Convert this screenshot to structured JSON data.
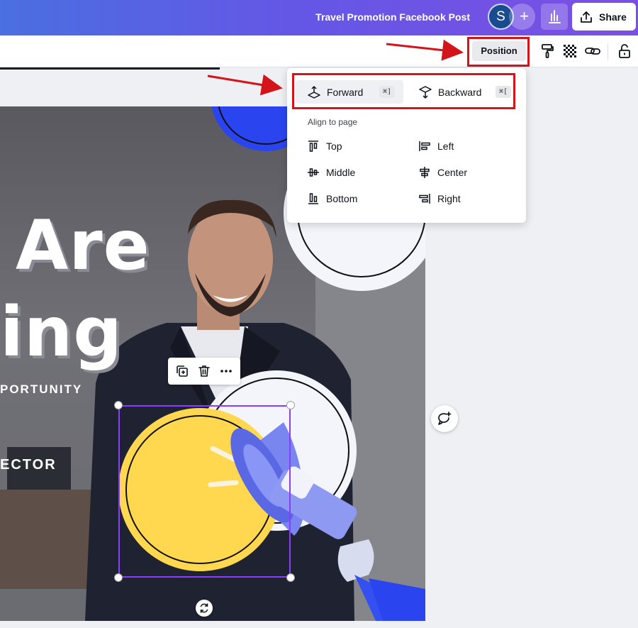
{
  "header": {
    "doc_title": "Travel Promotion Facebook Post",
    "avatar_initial": "S",
    "add_label": "+",
    "share_label": "Share"
  },
  "toolbar": {
    "position_label": "Position"
  },
  "canvas": {
    "headline_line1": "Are",
    "headline_line2": "ing",
    "subline1": "PORTUNITY",
    "subline2": "ECTOR"
  },
  "position_menu": {
    "forward_label": "Forward",
    "forward_shortcut": "⌘]",
    "backward_label": "Backward",
    "backward_shortcut": "⌘[",
    "align_heading": "Align to page",
    "align_items": {
      "top": "Top",
      "middle": "Middle",
      "bottom": "Bottom",
      "left": "Left",
      "center": "Center",
      "right": "Right"
    }
  },
  "colors": {
    "accent_purple": "#8b3dff",
    "annotation_red": "#d4141b",
    "yellow": "#ffd84f",
    "blue": "#2a44f0",
    "megaphone": "#7a86f0"
  }
}
